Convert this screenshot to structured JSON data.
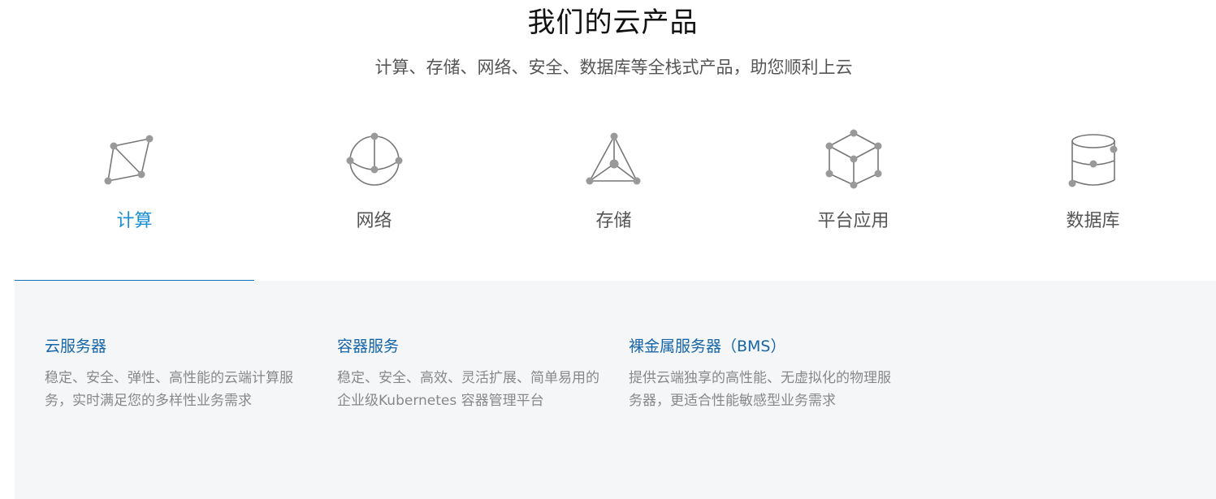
{
  "header": {
    "title": "我们的云产品",
    "subtitle": "计算、存储、网络、安全、数据库等全栈式产品，助您顺利上云"
  },
  "tabs": [
    {
      "label": "计算",
      "icon": "compute-icon",
      "active": true
    },
    {
      "label": "网络",
      "icon": "network-icon",
      "active": false
    },
    {
      "label": "存储",
      "icon": "storage-icon",
      "active": false
    },
    {
      "label": "平台应用",
      "icon": "platform-icon",
      "active": false
    },
    {
      "label": "数据库",
      "icon": "database-icon",
      "active": false
    }
  ],
  "products": [
    {
      "title": "云服务器",
      "description": "稳定、安全、弹性、高性能的云端计算服务，实时满足您的多样性业务需求"
    },
    {
      "title": "容器服务",
      "description": "稳定、安全、高效、灵活扩展、简单易用的企业级Kubernetes 容器管理平台"
    },
    {
      "title": "裸金属服务器（BMS）",
      "description": "提供云端独享的高性能、无虚拟化的物理服务器，更适合性能敏感型业务需求"
    }
  ],
  "colors": {
    "accent": "#1a8fd4",
    "underline": "#1670b8",
    "product_title": "#1565a8",
    "panel_bg": "#f5f6f8"
  }
}
